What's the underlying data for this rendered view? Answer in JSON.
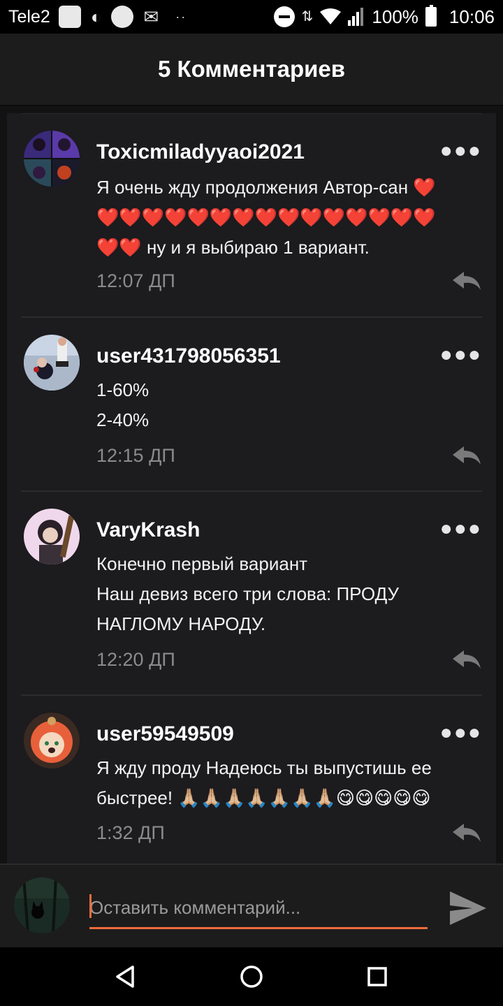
{
  "status_bar": {
    "carrier": "Tele2",
    "battery": "100%",
    "time": "10:06"
  },
  "header": {
    "title": "5 Комментариев"
  },
  "comments": [
    {
      "username": "Toxicmiladyyaoi2021",
      "lines": [
        "Я очень жду продолжения Автор-сан ❤️",
        "❤️❤️❤️❤️❤️❤️❤️❤️❤️❤️❤️❤️❤️❤️❤️",
        "❤️❤️ ну и я выбираю 1 вариант."
      ],
      "time": "12:07 ДП"
    },
    {
      "username": "user431798056351",
      "lines": [
        "1-60%",
        "2-40%"
      ],
      "time": "12:15 ДП"
    },
    {
      "username": "VaryKrash",
      "lines": [
        "Конечно первый вариант",
        "Наш девиз всего три слова: ПРОДУ",
        "НАГЛОМУ НАРОДУ."
      ],
      "time": "12:20 ДП"
    },
    {
      "username": "user59549509",
      "lines": [
        "Я жду проду Надеюсь ты выпустишь ее",
        "быстрее! 🙏🏼🙏🏼🙏🏼🙏🏼🙏🏼🙏🏼🙏🏼😋😋😋😋😋"
      ],
      "time": "1:32 ДП"
    }
  ],
  "input": {
    "placeholder": "Оставить комментарий..."
  },
  "colors": {
    "accent": "#ef6c3c",
    "background": "#1c1b1e"
  }
}
